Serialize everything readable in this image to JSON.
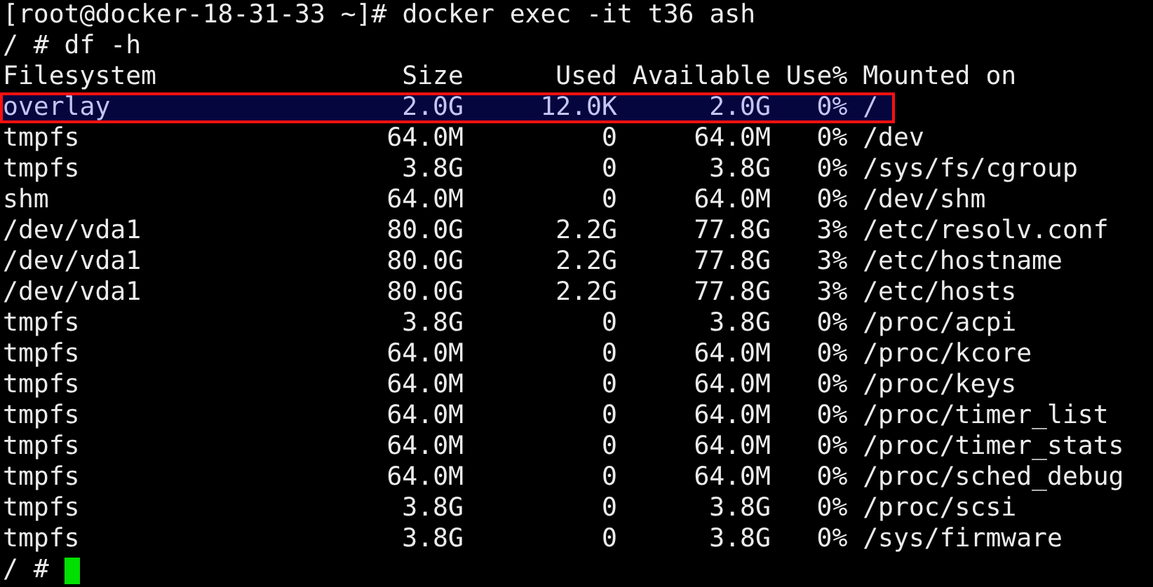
{
  "terminal": {
    "lines": [
      {
        "text": "[root@docker-18-31-33 ~]# docker exec -it t36 ash"
      },
      {
        "text": "/ # df -h"
      }
    ],
    "df_table": {
      "columns": [
        "Filesystem",
        "Size",
        "Used",
        "Available",
        "Use%",
        "Mounted on"
      ],
      "rows": [
        {
          "cells": [
            "overlay",
            "2.0G",
            "12.0K",
            "2.0G",
            "0%",
            "/"
          ],
          "selected": true
        },
        {
          "cells": [
            "tmpfs",
            "64.0M",
            "0",
            "64.0M",
            "0%",
            "/dev"
          ],
          "selected": false
        },
        {
          "cells": [
            "tmpfs",
            "3.8G",
            "0",
            "3.8G",
            "0%",
            "/sys/fs/cgroup"
          ],
          "selected": false
        },
        {
          "cells": [
            "shm",
            "64.0M",
            "0",
            "64.0M",
            "0%",
            "/dev/shm"
          ],
          "selected": false
        },
        {
          "cells": [
            "/dev/vda1",
            "80.0G",
            "2.2G",
            "77.8G",
            "3%",
            "/etc/resolv.conf"
          ],
          "selected": false
        },
        {
          "cells": [
            "/dev/vda1",
            "80.0G",
            "2.2G",
            "77.8G",
            "3%",
            "/etc/hostname"
          ],
          "selected": false
        },
        {
          "cells": [
            "/dev/vda1",
            "80.0G",
            "2.2G",
            "77.8G",
            "3%",
            "/etc/hosts"
          ],
          "selected": false
        },
        {
          "cells": [
            "tmpfs",
            "3.8G",
            "0",
            "3.8G",
            "0%",
            "/proc/acpi"
          ],
          "selected": false
        },
        {
          "cells": [
            "tmpfs",
            "64.0M",
            "0",
            "64.0M",
            "0%",
            "/proc/kcore"
          ],
          "selected": false
        },
        {
          "cells": [
            "tmpfs",
            "64.0M",
            "0",
            "64.0M",
            "0%",
            "/proc/keys"
          ],
          "selected": false
        },
        {
          "cells": [
            "tmpfs",
            "64.0M",
            "0",
            "64.0M",
            "0%",
            "/proc/timer_list"
          ],
          "selected": false
        },
        {
          "cells": [
            "tmpfs",
            "64.0M",
            "0",
            "64.0M",
            "0%",
            "/proc/timer_stats"
          ],
          "selected": false
        },
        {
          "cells": [
            "tmpfs",
            "64.0M",
            "0",
            "64.0M",
            "0%",
            "/proc/sched_debug"
          ],
          "selected": false
        },
        {
          "cells": [
            "tmpfs",
            "3.8G",
            "0",
            "3.8G",
            "0%",
            "/proc/scsi"
          ],
          "selected": false
        },
        {
          "cells": [
            "tmpfs",
            "3.8G",
            "0",
            "3.8G",
            "0%",
            "/sys/firmware"
          ],
          "selected": false
        }
      ]
    },
    "prompt": {
      "text": "/ #",
      "cursor": true
    }
  }
}
